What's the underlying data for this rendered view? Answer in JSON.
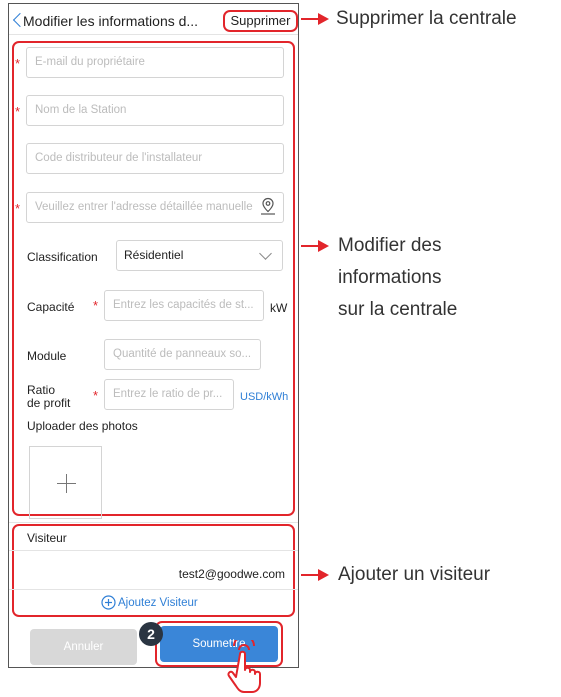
{
  "header": {
    "title": "Modifier les informations d...",
    "delete_label": "Supprimer"
  },
  "form": {
    "owner_email_placeholder": "E-mail du propriétaire",
    "station_name_placeholder": "Nom de la Station",
    "distributor_code_placeholder": "Code distributeur de l'installateur",
    "address_placeholder": "Veuillez entrer l'adresse détaillée manuelle",
    "classification_label": "Classification",
    "classification_value": "Résidentiel",
    "capacity_label": "Capacité",
    "capacity_placeholder": "Entrez les capacités de st...",
    "capacity_unit": "kW",
    "module_label": "Module",
    "module_placeholder": "Quantité de panneaux so...",
    "ratio_label_1": "Ratio",
    "ratio_label_2": "de profit",
    "ratio_placeholder": "Entrez le ratio de pr...",
    "ratio_unit": "USD/kWh",
    "upload_label": "Uploader des photos"
  },
  "visitor": {
    "section_label": "Visiteur",
    "email": "test2@goodwe.com",
    "add_label": "Ajoutez Visiteur"
  },
  "footer": {
    "cancel_label": "Annuler",
    "submit_label": "Soumettre",
    "step_badge": "2"
  },
  "callouts": {
    "delete": "Supprimer la centrale",
    "modify_1": "Modifier des",
    "modify_2": "informations",
    "modify_3": "sur la centrale",
    "add_visitor": "Ajouter un visiteur"
  },
  "colors": {
    "accent": "#2f7fd6",
    "highlight": "#e2252b",
    "submit": "#3a86d8",
    "cancel": "#d8d8d8"
  }
}
